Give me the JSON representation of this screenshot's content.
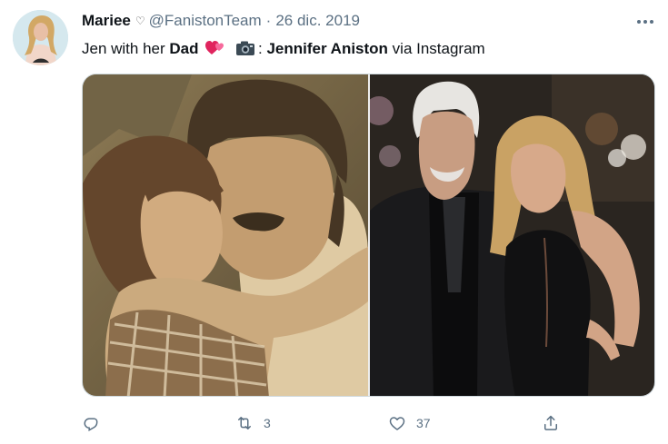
{
  "tweet": {
    "display_name": "Mariee",
    "name_emoji": "♡",
    "handle": "@FanistonTeam",
    "separator": "·",
    "timestamp": "26 dic. 2019",
    "text": {
      "part1": "Jen with her ",
      "bold1": "Dad",
      "camera_colon": ": ",
      "bold2": "Jennifer Aniston",
      "part2": " via Instagram"
    },
    "actions": {
      "reply_count": "",
      "retweet_count": "3",
      "like_count": "37"
    }
  },
  "icons": {
    "more": "more-horizontal-icon",
    "emoji_hearts": "two-hearts-emoji",
    "emoji_camera": "camera-emoji",
    "reply": "reply-icon",
    "retweet": "retweet-icon",
    "like": "heart-icon",
    "share": "share-icon"
  },
  "colors": {
    "secondary_text": "#5b7083",
    "primary_text": "#0f1419",
    "border": "#cfd9de"
  }
}
